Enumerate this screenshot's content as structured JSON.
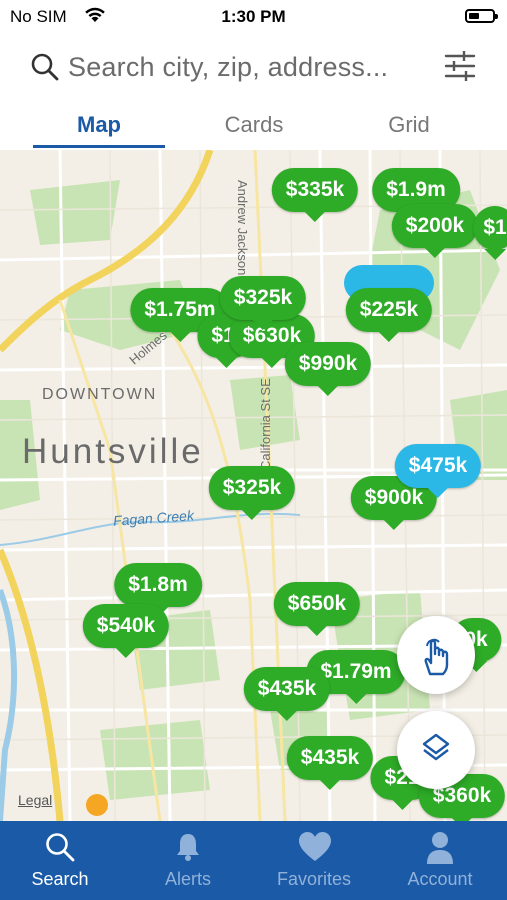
{
  "status_bar": {
    "carrier": "No SIM",
    "time": "1:30 PM"
  },
  "search": {
    "placeholder": "Search city, zip, address..."
  },
  "tabs": [
    {
      "label": "Map",
      "active": true
    },
    {
      "label": "Cards"
    },
    {
      "label": "Grid"
    }
  ],
  "map": {
    "labels": {
      "downtown": "DOWNTOWN",
      "city": "Huntsville",
      "creek": "Fagan Creek",
      "street1": "Andrew Jackson Wa",
      "street2": "California St SE",
      "street3": "Holmes",
      "legal": "Legal"
    },
    "pins": [
      {
        "label": "$335k",
        "color": "green"
      },
      {
        "label": "$1.9m",
        "color": "green"
      },
      {
        "label": "$200k",
        "color": "green"
      },
      {
        "label": "$1",
        "color": "green"
      },
      {
        "label": "$1.75m",
        "color": "green"
      },
      {
        "label": "$1.",
        "color": "green"
      },
      {
        "label": "$325k",
        "color": "green"
      },
      {
        "label": "$630k",
        "color": "green"
      },
      {
        "label": "$990k",
        "color": "green"
      },
      {
        "label": "$225k",
        "color": "green"
      },
      {
        "label": "$475k",
        "color": "blue"
      },
      {
        "label": "$325k",
        "color": "green"
      },
      {
        "label": "$900k",
        "color": "green"
      },
      {
        "label": "$1.8m",
        "color": "green"
      },
      {
        "label": "$540k",
        "color": "green"
      },
      {
        "label": "$650k",
        "color": "green"
      },
      {
        "label": "$1.79m",
        "color": "green"
      },
      {
        "label": "$435k",
        "color": "green"
      },
      {
        "label": "$435k",
        "color": "green"
      },
      {
        "label": "$21",
        "color": "green"
      },
      {
        "label": "$360k",
        "color": "green"
      },
      {
        "label": "0k",
        "color": "green"
      }
    ]
  },
  "nav": [
    {
      "label": "Search",
      "icon": "search-icon",
      "active": true
    },
    {
      "label": "Alerts",
      "icon": "bell-icon"
    },
    {
      "label": "Favorites",
      "icon": "heart-icon"
    },
    {
      "label": "Account",
      "icon": "person-icon"
    }
  ],
  "colors": {
    "brand_blue": "#1b5aa6",
    "pin_green": "#2eab27",
    "pin_blue": "#2cb8e6"
  }
}
